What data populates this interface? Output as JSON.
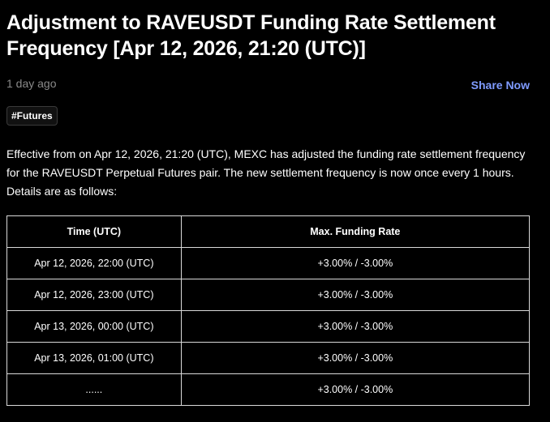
{
  "article": {
    "title": "Adjustment to RAVEUSDT Funding Rate Settlement Frequency [Apr 12, 2026, 21:20 (UTC)]",
    "time_ago": "1 day ago",
    "share_label": "Share Now",
    "tag": "#Futures",
    "body": "Effective from on Apr 12, 2026, 21:20 (UTC), MEXC has adjusted the funding rate settlement frequency for the RAVEUSDT Perpetual Futures pair. The new settlement frequency is now once every 1 hours. Details are as follows:"
  },
  "table": {
    "headers": [
      "Time (UTC)",
      "Max. Funding Rate"
    ],
    "rows": [
      [
        "Apr 12, 2026, 22:00 (UTC)",
        "+3.00% / -3.00%"
      ],
      [
        "Apr 12, 2026, 23:00 (UTC)",
        "+3.00% / -3.00%"
      ],
      [
        "Apr 13, 2026, 00:00 (UTC)",
        "+3.00% / -3.00%"
      ],
      [
        "Apr 13, 2026, 01:00 (UTC)",
        "+3.00% / -3.00%"
      ],
      [
        "......",
        "+3.00% / -3.00%"
      ]
    ]
  },
  "colors": {
    "background": "#000000",
    "text": "#ffffff",
    "muted": "#8a8a8a",
    "link": "#7f9bff",
    "table_border": "#d9d9d9"
  }
}
